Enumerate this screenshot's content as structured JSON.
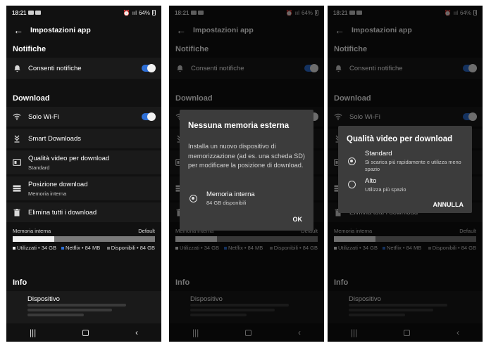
{
  "status": {
    "time": "18:21",
    "battery": "64%"
  },
  "appbar": {
    "title": "Impostazioni app",
    "back_icon": "arrow-left-icon"
  },
  "notifications": {
    "section_title": "Notifiche",
    "allow_label": "Consenti notifiche",
    "allow_on": true
  },
  "download": {
    "section_title": "Download",
    "wifi_only_label": "Solo Wi-Fi",
    "wifi_only_on": true,
    "smart_downloads_label": "Smart Downloads",
    "video_quality_label": "Qualità video per download",
    "video_quality_value": "Standard",
    "location_label": "Posizione download",
    "location_value": "Memoria interna",
    "delete_all_label": "Elimina tutti i download"
  },
  "storage": {
    "title": "Memoria interna",
    "mode": "Default",
    "used_fraction": 0.29,
    "used_label": "Utilizzati • 34 GB",
    "netflix_label": "Netflix • 84 MB",
    "free_label": "Disponibili • 84 GB",
    "colors": {
      "used": "#f2f2f2",
      "netflix": "#2e6fd6",
      "free": "#7a7a7a"
    }
  },
  "info": {
    "section_title": "Info",
    "device_label": "Dispositivo"
  },
  "dialog_storage": {
    "title": "Nessuna memoria esterna",
    "text": "Installa un nuovo dispositivo di memorizzazione (ad es. una scheda SD) per modificare la posizione di download.",
    "option_label": "Memoria interna",
    "option_sub": "84 GB disponibili",
    "ok_label": "OK"
  },
  "dialog_quality": {
    "title": "Qualità video per download",
    "option1_label": "Standard",
    "option1_sub": "Si scarica più rapidamente e utilizza meno spazio",
    "option2_label": "Alto",
    "option2_sub": "Utilizza più spazio",
    "cancel_label": "ANNULLA",
    "selected": "Standard"
  }
}
